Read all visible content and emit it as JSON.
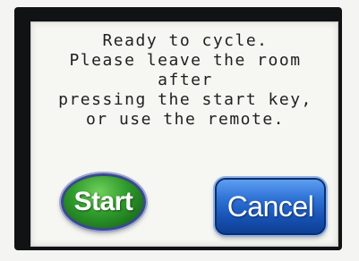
{
  "dialog": {
    "message_lines": [
      "Ready to cycle.",
      "Please leave the room",
      "after",
      "pressing the start key,",
      "or use the remote."
    ]
  },
  "buttons": {
    "start_label": "Start",
    "cancel_label": "Cancel"
  },
  "colors": {
    "start_button": "#2f9a2c",
    "cancel_button": "#1f5fc4",
    "screen_background": "#f6f6f2",
    "bezel": "#101214"
  }
}
